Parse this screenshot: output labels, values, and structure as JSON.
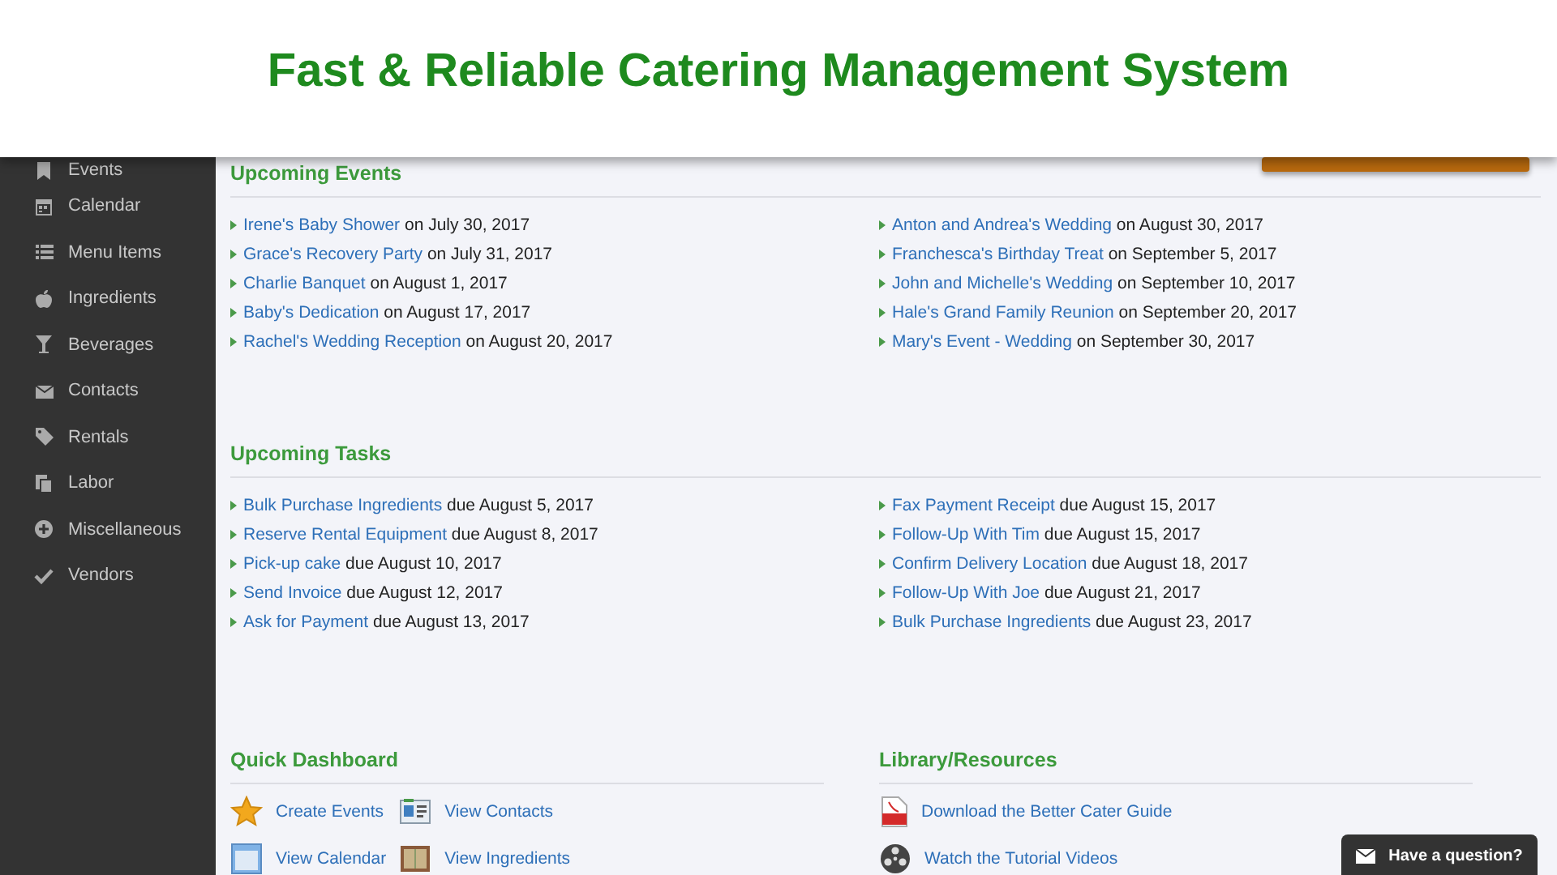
{
  "banner": {
    "title": "Fast & Reliable Catering Management System"
  },
  "sidebar": {
    "items": [
      {
        "label": "Events"
      },
      {
        "label": "Calendar"
      },
      {
        "label": "Menu Items"
      },
      {
        "label": "Ingredients"
      },
      {
        "label": "Beverages"
      },
      {
        "label": "Contacts"
      },
      {
        "label": "Rentals"
      },
      {
        "label": "Labor"
      },
      {
        "label": "Miscellaneous"
      },
      {
        "label": "Vendors"
      }
    ]
  },
  "upcoming_events": {
    "title": "Upcoming Events",
    "left": [
      {
        "link": "Irene's Baby Shower",
        "text": "on July 30, 2017"
      },
      {
        "link": "Grace's Recovery Party",
        "text": "on July 31, 2017"
      },
      {
        "link": "Charlie Banquet",
        "text": "on August 1, 2017"
      },
      {
        "link": "Baby's Dedication",
        "text": "on August 17, 2017"
      },
      {
        "link": "Rachel's Wedding Reception",
        "text": "on August 20, 2017"
      }
    ],
    "right": [
      {
        "link": "Anton and Andrea's Wedding",
        "text": "on August 30, 2017"
      },
      {
        "link": "Franchesca's Birthday Treat",
        "text": "on September 5, 2017"
      },
      {
        "link": "John and Michelle's Wedding",
        "text": "on September 10, 2017"
      },
      {
        "link": "Hale's Grand Family Reunion",
        "text": "on September 20, 2017"
      },
      {
        "link": "Mary's Event - Wedding",
        "text": "on September 30, 2017"
      }
    ]
  },
  "upcoming_tasks": {
    "title": "Upcoming Tasks",
    "left": [
      {
        "link": "Bulk Purchase Ingredients",
        "text": "due August 5, 2017"
      },
      {
        "link": "Reserve Rental Equipment",
        "text": "due August 8, 2017"
      },
      {
        "link": "Pick-up cake",
        "text": "due August 10, 2017"
      },
      {
        "link": "Send Invoice",
        "text": "due August 12, 2017"
      },
      {
        "link": "Ask for Payment",
        "text": "due August 13, 2017"
      }
    ],
    "right": [
      {
        "link": "Fax Payment Receipt",
        "text": "due August 15, 2017"
      },
      {
        "link": "Follow-Up With Tim",
        "text": "due August 15, 2017"
      },
      {
        "link": "Confirm Delivery Location",
        "text": "due August 18, 2017"
      },
      {
        "link": "Follow-Up With Joe",
        "text": "due August 21, 2017"
      },
      {
        "link": "Bulk Purchase Ingredients",
        "text": "due August 23, 2017"
      }
    ]
  },
  "quick_dashboard": {
    "title": "Quick Dashboard",
    "links": [
      "Create Events",
      "View Contacts",
      "View Calendar",
      "View Ingredients"
    ]
  },
  "library": {
    "title": "Library/Resources",
    "links": [
      "Download the Better Cater Guide",
      "Watch the Tutorial Videos"
    ]
  },
  "help_button": {
    "label": "Have a question?"
  }
}
